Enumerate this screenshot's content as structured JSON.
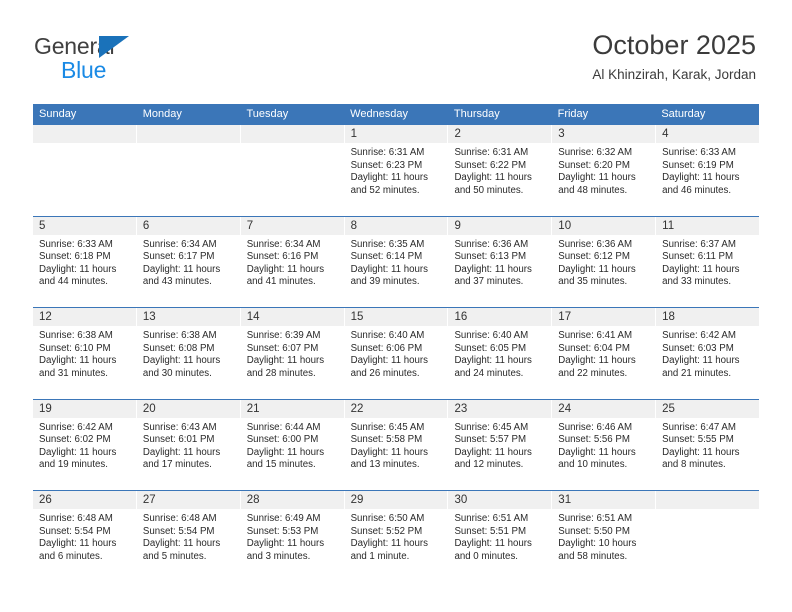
{
  "brand": {
    "name_part1": "General",
    "name_part2": "Blue",
    "triangle_color": "#1a72ba",
    "blue_color": "#1a8ae5"
  },
  "header": {
    "title": "October 2025",
    "subtitle": "Al Khinzirah, Karak, Jordan"
  },
  "theme": {
    "header_blue": "#3b76b8",
    "daynum_band": "#f0f0f0",
    "text": "#2a2a2a"
  },
  "weekdays": [
    "Sunday",
    "Monday",
    "Tuesday",
    "Wednesday",
    "Thursday",
    "Friday",
    "Saturday"
  ],
  "weeks": [
    [
      {
        "day": "",
        "empty": true,
        "lines": []
      },
      {
        "day": "",
        "empty": true,
        "lines": []
      },
      {
        "day": "",
        "empty": true,
        "lines": []
      },
      {
        "day": "1",
        "empty": false,
        "lines": [
          "Sunrise: 6:31 AM",
          "Sunset: 6:23 PM",
          "Daylight: 11 hours",
          "and 52 minutes."
        ]
      },
      {
        "day": "2",
        "empty": false,
        "lines": [
          "Sunrise: 6:31 AM",
          "Sunset: 6:22 PM",
          "Daylight: 11 hours",
          "and 50 minutes."
        ]
      },
      {
        "day": "3",
        "empty": false,
        "lines": [
          "Sunrise: 6:32 AM",
          "Sunset: 6:20 PM",
          "Daylight: 11 hours",
          "and 48 minutes."
        ]
      },
      {
        "day": "4",
        "empty": false,
        "lines": [
          "Sunrise: 6:33 AM",
          "Sunset: 6:19 PM",
          "Daylight: 11 hours",
          "and 46 minutes."
        ]
      }
    ],
    [
      {
        "day": "5",
        "empty": false,
        "lines": [
          "Sunrise: 6:33 AM",
          "Sunset: 6:18 PM",
          "Daylight: 11 hours",
          "and 44 minutes."
        ]
      },
      {
        "day": "6",
        "empty": false,
        "lines": [
          "Sunrise: 6:34 AM",
          "Sunset: 6:17 PM",
          "Daylight: 11 hours",
          "and 43 minutes."
        ]
      },
      {
        "day": "7",
        "empty": false,
        "lines": [
          "Sunrise: 6:34 AM",
          "Sunset: 6:16 PM",
          "Daylight: 11 hours",
          "and 41 minutes."
        ]
      },
      {
        "day": "8",
        "empty": false,
        "lines": [
          "Sunrise: 6:35 AM",
          "Sunset: 6:14 PM",
          "Daylight: 11 hours",
          "and 39 minutes."
        ]
      },
      {
        "day": "9",
        "empty": false,
        "lines": [
          "Sunrise: 6:36 AM",
          "Sunset: 6:13 PM",
          "Daylight: 11 hours",
          "and 37 minutes."
        ]
      },
      {
        "day": "10",
        "empty": false,
        "lines": [
          "Sunrise: 6:36 AM",
          "Sunset: 6:12 PM",
          "Daylight: 11 hours",
          "and 35 minutes."
        ]
      },
      {
        "day": "11",
        "empty": false,
        "lines": [
          "Sunrise: 6:37 AM",
          "Sunset: 6:11 PM",
          "Daylight: 11 hours",
          "and 33 minutes."
        ]
      }
    ],
    [
      {
        "day": "12",
        "empty": false,
        "lines": [
          "Sunrise: 6:38 AM",
          "Sunset: 6:10 PM",
          "Daylight: 11 hours",
          "and 31 minutes."
        ]
      },
      {
        "day": "13",
        "empty": false,
        "lines": [
          "Sunrise: 6:38 AM",
          "Sunset: 6:08 PM",
          "Daylight: 11 hours",
          "and 30 minutes."
        ]
      },
      {
        "day": "14",
        "empty": false,
        "lines": [
          "Sunrise: 6:39 AM",
          "Sunset: 6:07 PM",
          "Daylight: 11 hours",
          "and 28 minutes."
        ]
      },
      {
        "day": "15",
        "empty": false,
        "lines": [
          "Sunrise: 6:40 AM",
          "Sunset: 6:06 PM",
          "Daylight: 11 hours",
          "and 26 minutes."
        ]
      },
      {
        "day": "16",
        "empty": false,
        "lines": [
          "Sunrise: 6:40 AM",
          "Sunset: 6:05 PM",
          "Daylight: 11 hours",
          "and 24 minutes."
        ]
      },
      {
        "day": "17",
        "empty": false,
        "lines": [
          "Sunrise: 6:41 AM",
          "Sunset: 6:04 PM",
          "Daylight: 11 hours",
          "and 22 minutes."
        ]
      },
      {
        "day": "18",
        "empty": false,
        "lines": [
          "Sunrise: 6:42 AM",
          "Sunset: 6:03 PM",
          "Daylight: 11 hours",
          "and 21 minutes."
        ]
      }
    ],
    [
      {
        "day": "19",
        "empty": false,
        "lines": [
          "Sunrise: 6:42 AM",
          "Sunset: 6:02 PM",
          "Daylight: 11 hours",
          "and 19 minutes."
        ]
      },
      {
        "day": "20",
        "empty": false,
        "lines": [
          "Sunrise: 6:43 AM",
          "Sunset: 6:01 PM",
          "Daylight: 11 hours",
          "and 17 minutes."
        ]
      },
      {
        "day": "21",
        "empty": false,
        "lines": [
          "Sunrise: 6:44 AM",
          "Sunset: 6:00 PM",
          "Daylight: 11 hours",
          "and 15 minutes."
        ]
      },
      {
        "day": "22",
        "empty": false,
        "lines": [
          "Sunrise: 6:45 AM",
          "Sunset: 5:58 PM",
          "Daylight: 11 hours",
          "and 13 minutes."
        ]
      },
      {
        "day": "23",
        "empty": false,
        "lines": [
          "Sunrise: 6:45 AM",
          "Sunset: 5:57 PM",
          "Daylight: 11 hours",
          "and 12 minutes."
        ]
      },
      {
        "day": "24",
        "empty": false,
        "lines": [
          "Sunrise: 6:46 AM",
          "Sunset: 5:56 PM",
          "Daylight: 11 hours",
          "and 10 minutes."
        ]
      },
      {
        "day": "25",
        "empty": false,
        "lines": [
          "Sunrise: 6:47 AM",
          "Sunset: 5:55 PM",
          "Daylight: 11 hours",
          "and 8 minutes."
        ]
      }
    ],
    [
      {
        "day": "26",
        "empty": false,
        "lines": [
          "Sunrise: 6:48 AM",
          "Sunset: 5:54 PM",
          "Daylight: 11 hours",
          "and 6 minutes."
        ]
      },
      {
        "day": "27",
        "empty": false,
        "lines": [
          "Sunrise: 6:48 AM",
          "Sunset: 5:54 PM",
          "Daylight: 11 hours",
          "and 5 minutes."
        ]
      },
      {
        "day": "28",
        "empty": false,
        "lines": [
          "Sunrise: 6:49 AM",
          "Sunset: 5:53 PM",
          "Daylight: 11 hours",
          "and 3 minutes."
        ]
      },
      {
        "day": "29",
        "empty": false,
        "lines": [
          "Sunrise: 6:50 AM",
          "Sunset: 5:52 PM",
          "Daylight: 11 hours",
          "and 1 minute."
        ]
      },
      {
        "day": "30",
        "empty": false,
        "lines": [
          "Sunrise: 6:51 AM",
          "Sunset: 5:51 PM",
          "Daylight: 11 hours",
          "and 0 minutes."
        ]
      },
      {
        "day": "31",
        "empty": false,
        "lines": [
          "Sunrise: 6:51 AM",
          "Sunset: 5:50 PM",
          "Daylight: 10 hours",
          "and 58 minutes."
        ]
      },
      {
        "day": "",
        "empty": true,
        "lines": []
      }
    ]
  ]
}
